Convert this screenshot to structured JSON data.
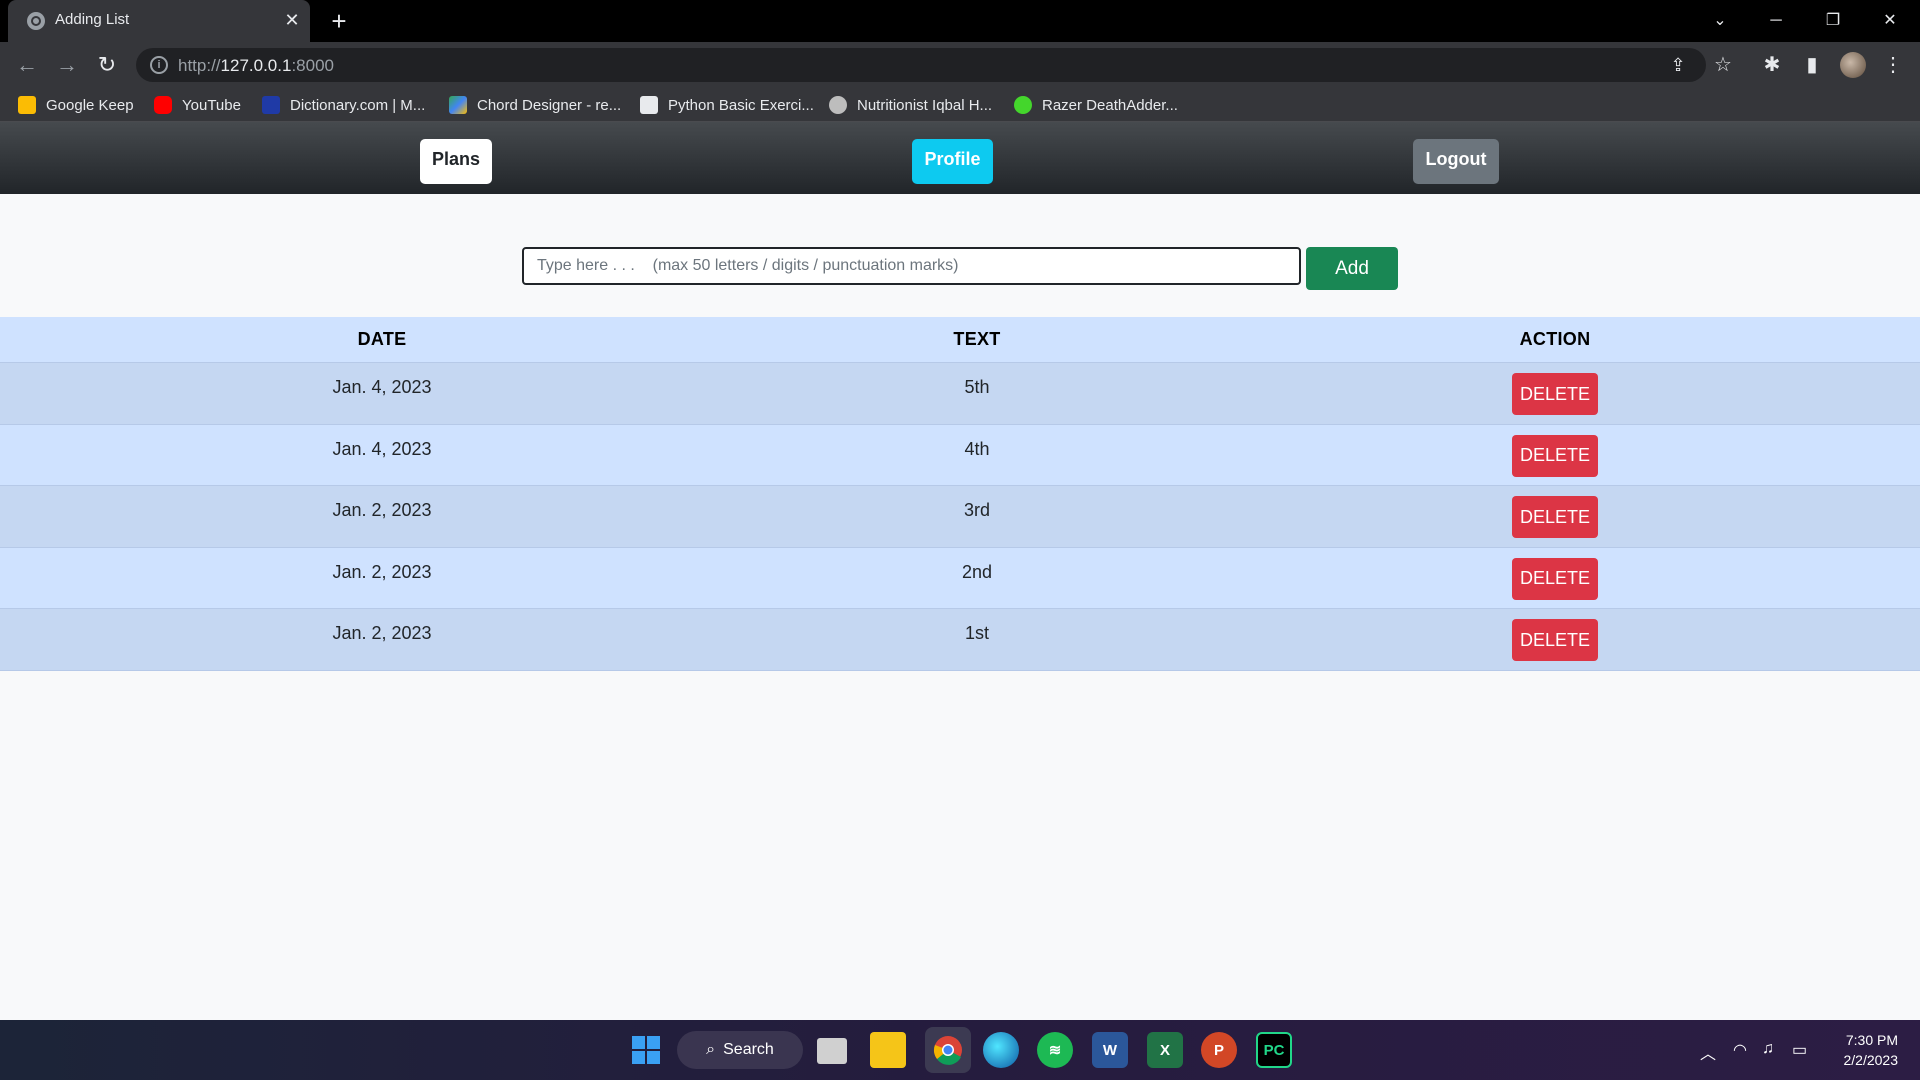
{
  "browser": {
    "tab_title": "Adding List",
    "url_prefix": "http://",
    "url_host": "127.0.0.1",
    "url_port": ":8000",
    "bookmarks": [
      {
        "label": "Google Keep",
        "icon": "google-keep-icon",
        "color": "#fbbc04"
      },
      {
        "label": "YouTube",
        "icon": "youtube-icon",
        "color": "#ff0000"
      },
      {
        "label": "Dictionary.com | M...",
        "icon": "dictionary-icon",
        "color": "#1f3aa6"
      },
      {
        "label": "Chord Designer - re...",
        "icon": "google-play-icon",
        "color": "#34a853"
      },
      {
        "label": "Python Basic Exerci...",
        "icon": "w3resource-icon",
        "color": "#e8eaed"
      },
      {
        "label": "Nutritionist Iqbal H...",
        "icon": "nutritionist-icon",
        "color": "#e8eaed"
      },
      {
        "label": "Razer DeathAdder...",
        "icon": "razer-icon",
        "color": "#44d62c"
      }
    ]
  },
  "nav": {
    "plans": "Plans",
    "profile": "Profile",
    "logout": "Logout"
  },
  "form": {
    "placeholder": "Type here . . .    (max 50 letters / digits / punctuation marks)",
    "add_label": "Add"
  },
  "table": {
    "headers": [
      "DATE",
      "TEXT",
      "ACTION"
    ],
    "rows": [
      {
        "date": "Jan. 4, 2023",
        "text": "5th",
        "action": "DELETE"
      },
      {
        "date": "Jan. 4, 2023",
        "text": "4th",
        "action": "DELETE"
      },
      {
        "date": "Jan. 2, 2023",
        "text": "3rd",
        "action": "DELETE"
      },
      {
        "date": "Jan. 2, 2023",
        "text": "2nd",
        "action": "DELETE"
      },
      {
        "date": "Jan. 2, 2023",
        "text": "1st",
        "action": "DELETE"
      }
    ]
  },
  "taskbar": {
    "search_label": "Search",
    "time": "7:30 PM",
    "date": "2/2/2023"
  },
  "colors": {
    "nav_bg": "#212529",
    "profile_accent": "#0dcaf0",
    "logout_gray": "#6c757d",
    "add_green": "#198754",
    "delete_red": "#dc3545",
    "table_header_bg": "#cfe2ff"
  }
}
